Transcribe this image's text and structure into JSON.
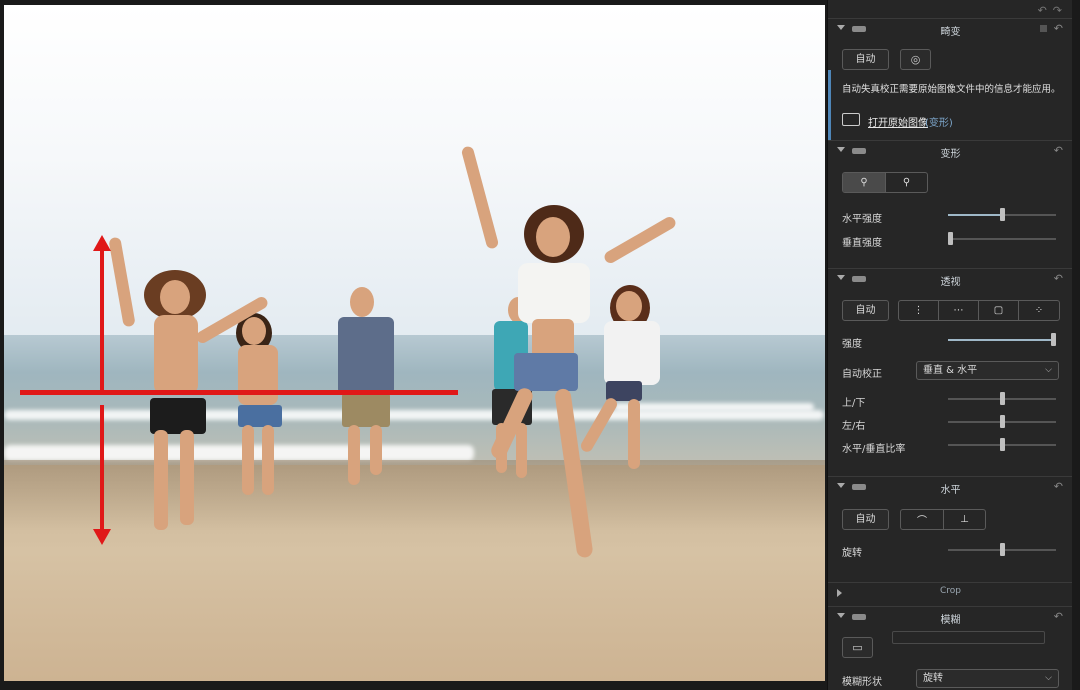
{
  "panel": {
    "header_icons": [
      "undo-icon",
      "redo-icon"
    ],
    "distortion": {
      "title": "畸变",
      "auto_label": "自动",
      "note": "自动失真校正需要原始图像文件中的信息才能应用。",
      "open_original_label": "打开原始图像",
      "open_original_suffix": "(变形)"
    },
    "transform": {
      "title": "变形",
      "horizontal_strength_label": "水平强度",
      "horizontal_strength_value": 0.5,
      "vertical_strength_label": "垂直强度",
      "vertical_strength_value": 0.0
    },
    "perspective": {
      "title": "透视",
      "auto_label": "自动",
      "strength_label": "强度",
      "strength_value": 1.0,
      "auto_correct_label": "自动校正",
      "auto_correct_value": "垂直 & 水平",
      "up_down_label": "上/下",
      "up_down_value": 0.5,
      "left_right_label": "左/右",
      "left_right_value": 0.5,
      "ratio_label": "水平/垂直比率",
      "ratio_value": 0.5
    },
    "level": {
      "title": "水平",
      "auto_label": "自动",
      "rotate_label": "旋转",
      "rotate_value": 0.5
    },
    "crop": {
      "title": "Crop"
    },
    "blur": {
      "title": "模糊",
      "shape_label": "模糊形状",
      "shape_value": "旋转"
    }
  },
  "colors": {
    "guide": "#e01818",
    "panel_bg": "#262626",
    "accent": "#4f86b8"
  }
}
